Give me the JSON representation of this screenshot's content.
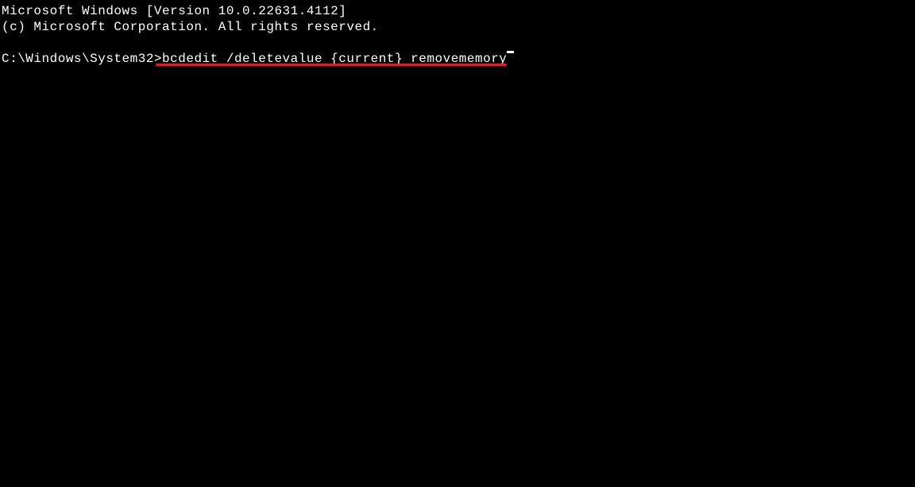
{
  "header": {
    "line1": "Microsoft Windows [Version 10.0.22631.4112]",
    "line2": "(c) Microsoft Corporation. All rights reserved."
  },
  "prompt": {
    "path": "C:\\Windows\\System32>",
    "command": "bcdedit /deletevalue {current} removememory"
  }
}
